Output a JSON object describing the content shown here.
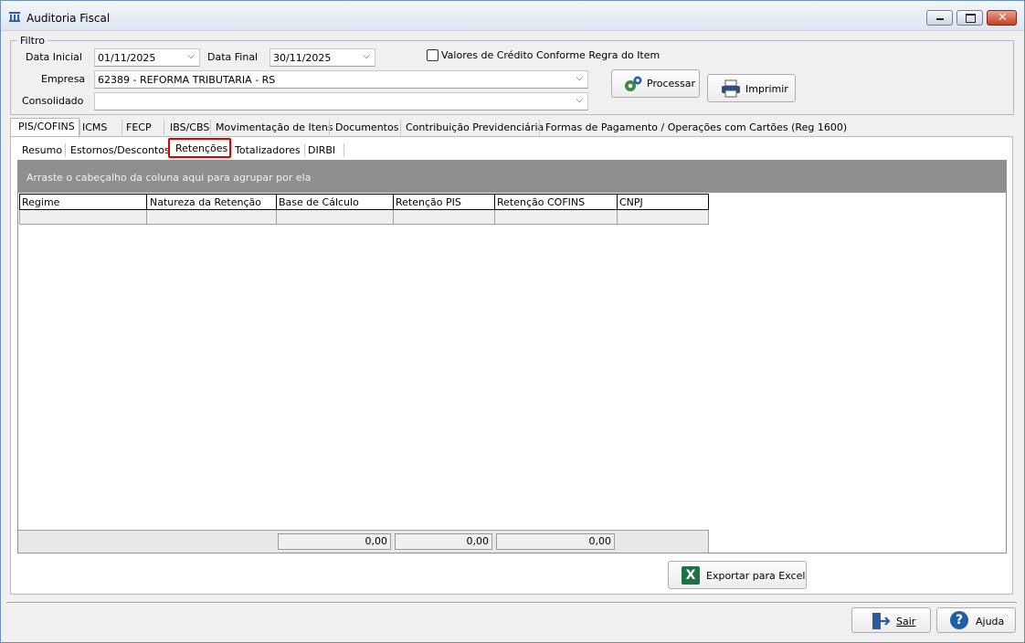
{
  "window": {
    "title": "Auditoria Fiscal"
  },
  "filtro": {
    "group_label": "Filtro",
    "data_inicial_label": "Data Inicial",
    "data_inicial_value": "01/11/2025",
    "data_final_label": "Data Final",
    "data_final_value": "30/11/2025",
    "checkbox_label": "Valores de Crédito Conforme Regra do Item",
    "checkbox_checked": false,
    "empresa_label": "Empresa",
    "empresa_value": "62389 - REFORMA TRIBUTARIA - RS",
    "consolidado_label": "Consolidado",
    "consolidado_value": ""
  },
  "buttons": {
    "processar": "Processar",
    "imprimir": "Imprimir",
    "exportar": "Exportar para Excel",
    "sair": "Sair",
    "ajuda": "Ajuda"
  },
  "main_tabs": [
    "PIS/COFINS",
    "ICMS",
    "FECP",
    "IBS/CBS",
    "Movimentação de Itens",
    "Documentos",
    "Contribuição Previdenciária",
    "Formas de Pagamento / Operações com Cartões  (Reg 1600)"
  ],
  "main_tab_active": "PIS/COFINS",
  "sub_tabs": [
    "Resumo",
    "Estornos/Descontos",
    "Retenções",
    "Totalizadores",
    "DIRBI"
  ],
  "sub_tab_active": "Retenções",
  "grid": {
    "group_hint": "Arraste o cabeçalho da coluna aqui para agrupar por ela",
    "columns": [
      "Regime",
      "Natureza da Retenção",
      "Base de Cálculo",
      "Retenção PIS",
      "Retenção COFINS",
      "CNPJ"
    ],
    "totals": [
      "0,00",
      "0,00",
      "0,00"
    ]
  },
  "colors": {
    "highlight_border": "#e00000",
    "group_panel": "#8f8f8f",
    "excel_green": "#1e7145",
    "help_blue": "#1f5fa8"
  }
}
